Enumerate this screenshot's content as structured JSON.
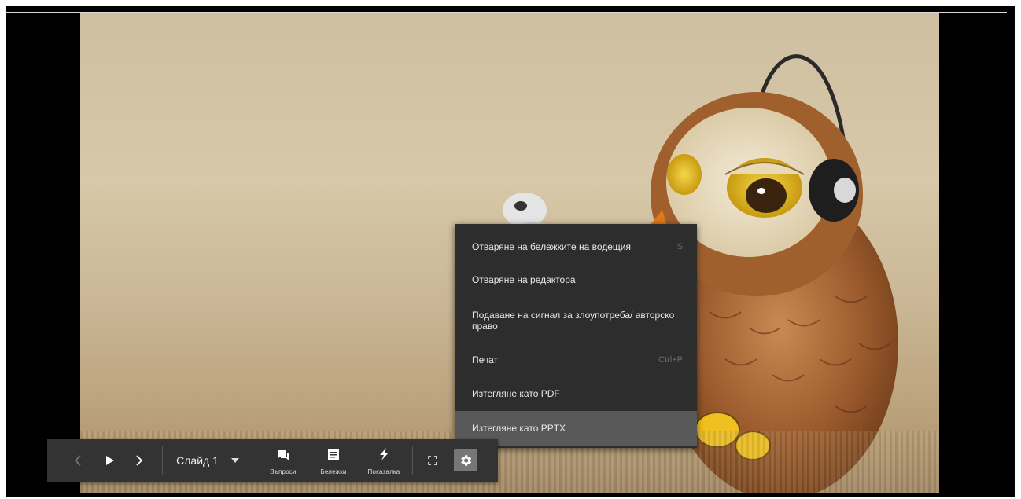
{
  "menu": {
    "items": [
      {
        "label": "Отваряне на бележките на водещия",
        "shortcut": "S"
      },
      {
        "label": "Отваряне на редактора",
        "shortcut": ""
      },
      {
        "label": "Подаване на сигнал за злоупотреба/ авторско право",
        "shortcut": ""
      },
      {
        "label": "Печат",
        "shortcut": "Ctrl+P"
      },
      {
        "label": "Изтегляне като PDF",
        "shortcut": ""
      },
      {
        "label": "Изтегляне като PPTX",
        "shortcut": ""
      }
    ],
    "highlighted_index": 5
  },
  "toolbar": {
    "slide_label": "Слайд 1",
    "questions_label": "Въпроси",
    "notes_label": "Бележки",
    "pointer_label": "Показалка"
  },
  "colors": {
    "toolbar_bg": "#333333",
    "menu_bg": "#2d2d2d",
    "menu_highlight": "#595959"
  },
  "icons": [
    "chevron-left-icon",
    "play-icon",
    "chevron-right-icon",
    "dropdown-arrow-icon",
    "questions-icon",
    "notes-icon",
    "pointer-icon",
    "fullscreen-icon",
    "gear-icon"
  ]
}
